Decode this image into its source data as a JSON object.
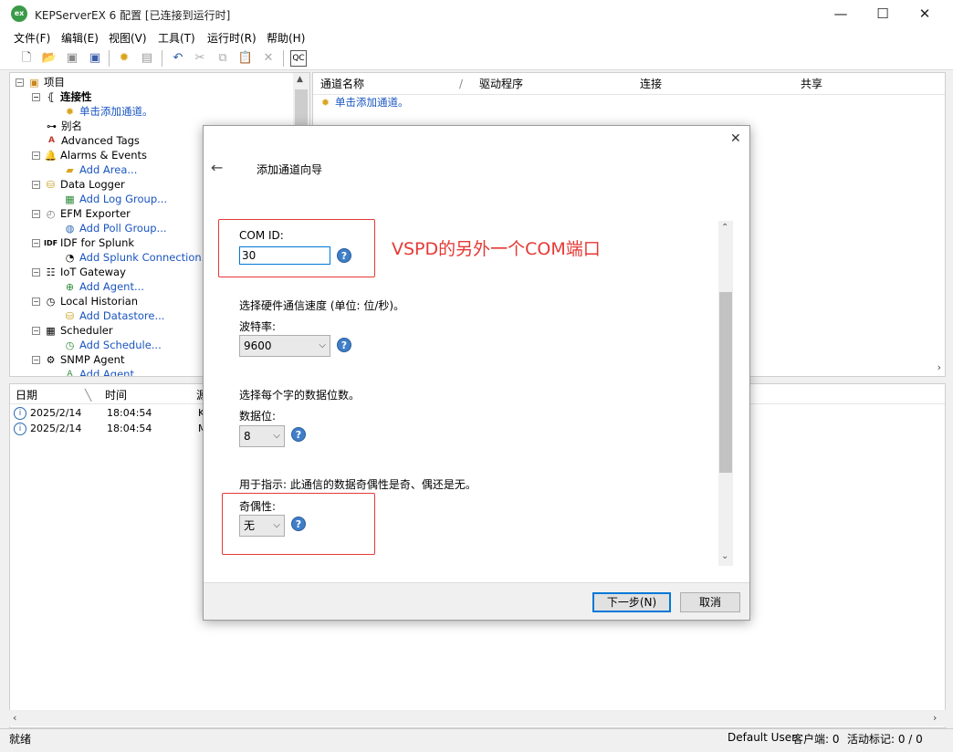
{
  "window": {
    "title": "KEPServerEX 6 配置 [已连接到运行时]",
    "logo": "ex",
    "minimize": "—",
    "maximize": "☐",
    "close": "✕"
  },
  "menu": [
    "文件(F)",
    "编辑(E)",
    "视图(V)",
    "工具(T)",
    "运行时(R)",
    "帮助(H)"
  ],
  "toolbar": {
    "icons": [
      "new-file-icon",
      "open-folder-icon",
      "save-icon",
      "save-as-icon",
      "new-channel-icon",
      "properties-icon",
      "undo-icon",
      "cut-icon",
      "copy-icon",
      "paste-icon",
      "delete-icon",
      "quick-client-icon"
    ]
  },
  "tree": {
    "root": "项目",
    "connectivity": "连接性",
    "add_channel": "单击添加通道。",
    "aliases": "别名",
    "advanced_tags": "Advanced Tags",
    "alarms": "Alarms & Events",
    "add_area": "Add Area...",
    "data_logger": "Data Logger",
    "add_log_group": "Add Log Group...",
    "efm": "EFM Exporter",
    "add_poll_group": "Add Poll Group...",
    "idf": "IDF for Splunk",
    "add_splunk": "Add Splunk Connection...",
    "iot": "IoT Gateway",
    "add_agent": "Add Agent...",
    "historian": "Local Historian",
    "add_datastore": "Add Datastore...",
    "scheduler": "Scheduler",
    "add_schedule": "Add Schedule...",
    "snmp": "SNMP Agent",
    "add_agent2": "Add Agent..."
  },
  "channel_table": {
    "columns": [
      "通道名称",
      "驱动程序",
      "连接",
      "共享"
    ],
    "add_row": "单击添加通道。"
  },
  "log": {
    "columns": [
      "日期",
      "时间",
      "源"
    ],
    "rows": [
      {
        "date": "2025/2/14",
        "time": "18:04:54",
        "src": "K"
      },
      {
        "date": "2025/2/14",
        "time": "18:04:54",
        "src": "M"
      }
    ]
  },
  "status": {
    "ready": "就绪",
    "user": "Default User",
    "clients": "客户端: 0",
    "active_tags": "活动标记: 0 / 0"
  },
  "dialog": {
    "title": "添加通道向导",
    "com_id_label": "COM ID:",
    "com_id_value": "30",
    "annotation": "VSPD的另外一个COM端口",
    "baud_desc": "选择硬件通信速度 (单位: 位/秒)。",
    "baud_label": "波特率:",
    "baud_value": "9600",
    "databits_desc": "选择每个字的数据位数。",
    "databits_label": "数据位:",
    "databits_value": "8",
    "parity_desc": "用于指示: 此通信的数据奇偶性是奇、偶还是无。",
    "parity_label": "奇偶性:",
    "parity_value": "无",
    "next": "下一步(N)",
    "cancel": "取消",
    "back_glyph": "←",
    "close_glyph": "✕"
  },
  "colors": {
    "annotation": "#e53935",
    "link": "#1a55c0"
  }
}
